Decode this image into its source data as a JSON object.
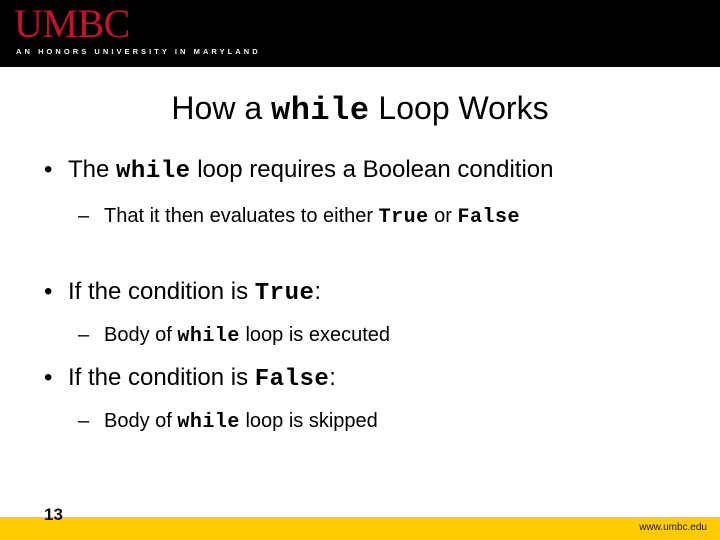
{
  "colors": {
    "header_background": "#000000",
    "logo_red": "#c4122f",
    "tagline_white": "#f2f2f2",
    "footer_gold": "#ffcc00",
    "body_text": "#000000",
    "slide_background": "#ffffff"
  },
  "header": {
    "wordmark": "UMBC",
    "tagline": "AN HONORS UNIVERSITY IN MARYLAND"
  },
  "title": {
    "part1": "How a ",
    "code": "while",
    "part2": " Loop Works",
    "full_text": "How a while Loop Works"
  },
  "body": {
    "lines": [
      {
        "level": 1,
        "marker": "•",
        "segments": [
          {
            "text": "The ",
            "style": "normal"
          },
          {
            "text": "while",
            "style": "code"
          },
          {
            "text": " loop requires a Boolean condition",
            "style": "normal"
          }
        ],
        "plain": "The while loop requires a Boolean condition"
      },
      {
        "level": 2,
        "marker": "–",
        "segments": [
          {
            "text": "That it then evaluates to either ",
            "style": "normal"
          },
          {
            "text": "True",
            "style": "code"
          },
          {
            "text": " or ",
            "style": "normal"
          },
          {
            "text": "False",
            "style": "code"
          }
        ],
        "plain": "That it then evaluates to either True or False"
      },
      {
        "level": 1,
        "marker": "•",
        "segments": [
          {
            "text": "If the condition is ",
            "style": "normal"
          },
          {
            "text": "True",
            "style": "code"
          },
          {
            "text": ":",
            "style": "normal"
          }
        ],
        "plain": "If the condition is True:"
      },
      {
        "level": 2,
        "marker": "–",
        "segments": [
          {
            "text": "Body of ",
            "style": "normal"
          },
          {
            "text": "while",
            "style": "code"
          },
          {
            "text": " loop is executed",
            "style": "normal"
          }
        ],
        "plain": "Body of while loop is executed"
      },
      {
        "level": 1,
        "marker": "•",
        "segments": [
          {
            "text": "If the condition is ",
            "style": "normal"
          },
          {
            "text": "False",
            "style": "code"
          },
          {
            "text": ":",
            "style": "normal"
          }
        ],
        "plain": "If the condition is False:"
      },
      {
        "level": 2,
        "marker": "–",
        "segments": [
          {
            "text": "Body of ",
            "style": "normal"
          },
          {
            "text": "while",
            "style": "code"
          },
          {
            "text": " loop is skipped",
            "style": "normal"
          }
        ],
        "plain": "Body of while loop is skipped"
      }
    ]
  },
  "footer": {
    "page_number": "13",
    "url": "www.umbc.edu"
  }
}
